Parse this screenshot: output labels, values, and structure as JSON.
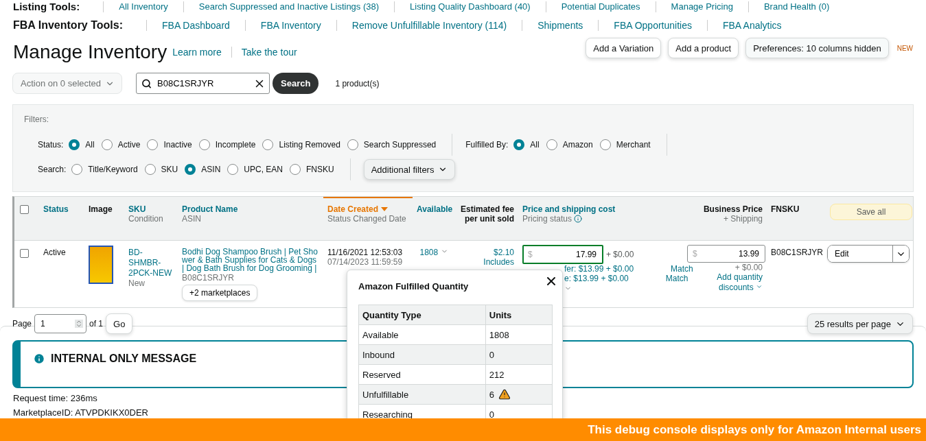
{
  "listing_tools": {
    "label": "Listing Tools:",
    "links": [
      "All Inventory",
      "Search Suppressed and Inactive Listings (38)",
      "Listing Quality Dashboard (40)",
      "Potential Duplicates",
      "Manage Pricing",
      "Brand Health (0)"
    ]
  },
  "fba_tools": {
    "label": "FBA Inventory Tools:",
    "links": [
      "FBA Dashboard",
      "FBA Inventory",
      "Remove Unfulfillable Inventory (114)",
      "Shipments",
      "FBA Opportunities",
      "FBA Analytics"
    ]
  },
  "header": {
    "title": "Manage Inventory",
    "links": [
      "Learn more",
      "Take the tour"
    ],
    "buttons": [
      "Add a Variation",
      "Add a product",
      "Preferences: 10 columns hidden"
    ],
    "badge": "NEW"
  },
  "toolbar": {
    "action": "Action on 0 selected",
    "search_value": "B08C1SRJYR",
    "search_button": "Search",
    "result_count": "1 product(s)"
  },
  "filters": {
    "title": "Filters:",
    "more_button": "Additional filters",
    "groups": [
      {
        "label": "Status:",
        "options": [
          {
            "label": "All",
            "selected": true
          },
          {
            "label": "Active",
            "selected": false
          },
          {
            "label": "Inactive",
            "selected": false
          },
          {
            "label": "Incomplete",
            "selected": false
          },
          {
            "label": "Listing Removed",
            "selected": false
          },
          {
            "label": "Search Suppressed",
            "selected": false
          }
        ]
      },
      {
        "label": "Fulfilled By:",
        "options": [
          {
            "label": "All",
            "selected": true
          },
          {
            "label": "Amazon",
            "selected": false
          },
          {
            "label": "Merchant",
            "selected": false
          }
        ]
      },
      {
        "label": "Search:",
        "options": [
          {
            "label": "Title/Keyword",
            "selected": false
          },
          {
            "label": "SKU",
            "selected": false
          },
          {
            "label": "ASIN",
            "selected": true
          },
          {
            "label": "UPC, EAN",
            "selected": false
          },
          {
            "label": "FNSKU",
            "selected": false
          }
        ]
      }
    ]
  },
  "table": {
    "header_checked": false,
    "save_all": "Save all",
    "columns": [
      {
        "title": "Status",
        "sortable": true,
        "sorted": false
      },
      {
        "title": "Image",
        "sortable": false,
        "sorted": false
      },
      {
        "title": "SKU",
        "subtitle": "Condition",
        "sortable": true,
        "sorted": false
      },
      {
        "title": "Product Name",
        "subtitle": "ASIN",
        "sortable": true,
        "sorted": false
      },
      {
        "title": "Date Created",
        "subtitle": "Status Changed Date",
        "sortable": true,
        "sorted": true
      },
      {
        "title": "Available",
        "sortable": true,
        "sorted": false
      },
      {
        "title": "Estimated fee per unit sold",
        "sortable": false,
        "sorted": false
      },
      {
        "title": "Price and shipping cost",
        "subtitle": "Pricing status",
        "sortable": true,
        "sorted": false
      },
      {
        "title": "Business Price",
        "subtitle": "+ Shipping",
        "sortable": false,
        "sorted": false
      },
      {
        "title": "FNSKU",
        "sortable": false,
        "sorted": false
      }
    ],
    "rows": [
      {
        "checked": false,
        "status": "Active",
        "sku": "BD-SHMBR-2PCK-NEW",
        "condition": "New",
        "product_name": "Bodhi Dog Shampoo Brush | Pet Shower & Bath Supplies for Cats & Dogs | Dog Bath Brush for Dog Grooming |",
        "asin": "B08C1SRJYR",
        "marketplaces": "+2 marketplaces",
        "date_created": "11/16/2021 12:53:03",
        "status_changed": "07/14/2023 11:59:59",
        "available": "1808",
        "fee": "$2.10",
        "fee_note": "Includes",
        "currency": "$",
        "price": "17.99",
        "shipping": "+ $0.00",
        "offers": [
          {
            "text": "fer: $13.99 + $0.00",
            "link": "Match"
          },
          {
            "text": "e: $13.99 + $0.00",
            "link": "Match"
          }
        ],
        "business_price": "13.99",
        "business_shipping": "+ $0.00",
        "business_link": "Add quantity discounts",
        "fnsku": "B08C1SRJYR",
        "action": "Edit"
      }
    ]
  },
  "pagination": {
    "label": "Page",
    "page": "1",
    "of": "of 1",
    "go": "Go",
    "per_page": "25 results per page"
  },
  "message": {
    "title": "INTERNAL ONLY MESSAGE",
    "lines": [
      "Request time: 236ms",
      "MarketplaceID: ATVPDKIKX0DER"
    ]
  },
  "popover": {
    "title": "Amazon Fulfilled Quantity",
    "columns": [
      "Quantity Type",
      "Units"
    ],
    "rows": [
      {
        "type": "Available",
        "units": "1808",
        "warning": false
      },
      {
        "type": "Inbound",
        "units": "0",
        "warning": false
      },
      {
        "type": "Reserved",
        "units": "212",
        "warning": false
      },
      {
        "type": "Unfulfillable",
        "units": "6",
        "warning": true
      },
      {
        "type": "Researching",
        "units": "0",
        "warning": false
      }
    ]
  },
  "debug_bar": "This debug console displays only for Amazon Internal users"
}
